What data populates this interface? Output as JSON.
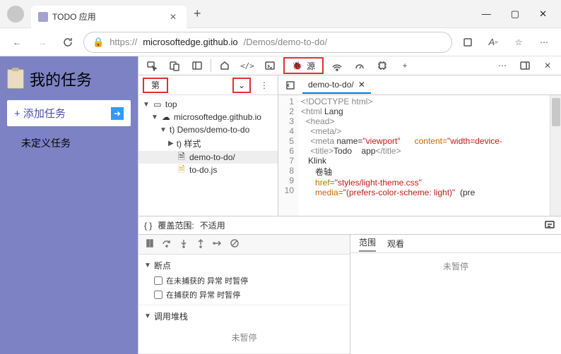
{
  "tab": {
    "title": "TODO 应用"
  },
  "url": {
    "scheme": "https://",
    "host": "microsoftedge.github.io",
    "path": "/Demos/demo-to-do/"
  },
  "app": {
    "title": "我的任务",
    "add_label": "+ 添加任务",
    "undefined_label": "未定义任务"
  },
  "devtools": {
    "sources_tab": "源",
    "page_tab": "第",
    "tree": {
      "top": "top",
      "origin": "microsoftedge.github.io",
      "folder": "t) Demos/demo-to-do",
      "styles": "t) 样式",
      "file_html": "demo-to-do/",
      "file_js": "to-do.js"
    },
    "open_file": "demo-to-do/",
    "code": {
      "l1": "<!DOCTYPE html>",
      "l2_a": "<html",
      "l2_b": "Lang",
      "l3": "<head>",
      "l4": "<meta/>",
      "l5_a": "<meta",
      "l5_b": "name=",
      "l5_c": "\"viewport\"",
      "l5_d": "content=",
      "l5_e": "\"width=device-",
      "l6_a": "<title>",
      "l6_b": "Todo",
      "l6_c": "app",
      "l6_d": "</title>",
      "l7": "Klink",
      "l8": "卷轴",
      "l9_a": "href=",
      "l9_b": "\"styles/light-theme.css\"",
      "l10_a": "media=",
      "l10_b": "\"(prefers-color-scheme: light)\"",
      "l10_c": "(pre"
    },
    "coverage_label": "覆盖范围:",
    "coverage_value": "不适用",
    "breakpoints": {
      "header": "断点",
      "uncaught": "在未捕获的 异常 时暂停",
      "caught": "在捕获的 异常 时暂停"
    },
    "callstack": {
      "header": "调用堆栈",
      "not_paused": "未暂停"
    },
    "scope_tab": "范围",
    "watch_tab": "观看",
    "not_paused": "未暂停"
  }
}
